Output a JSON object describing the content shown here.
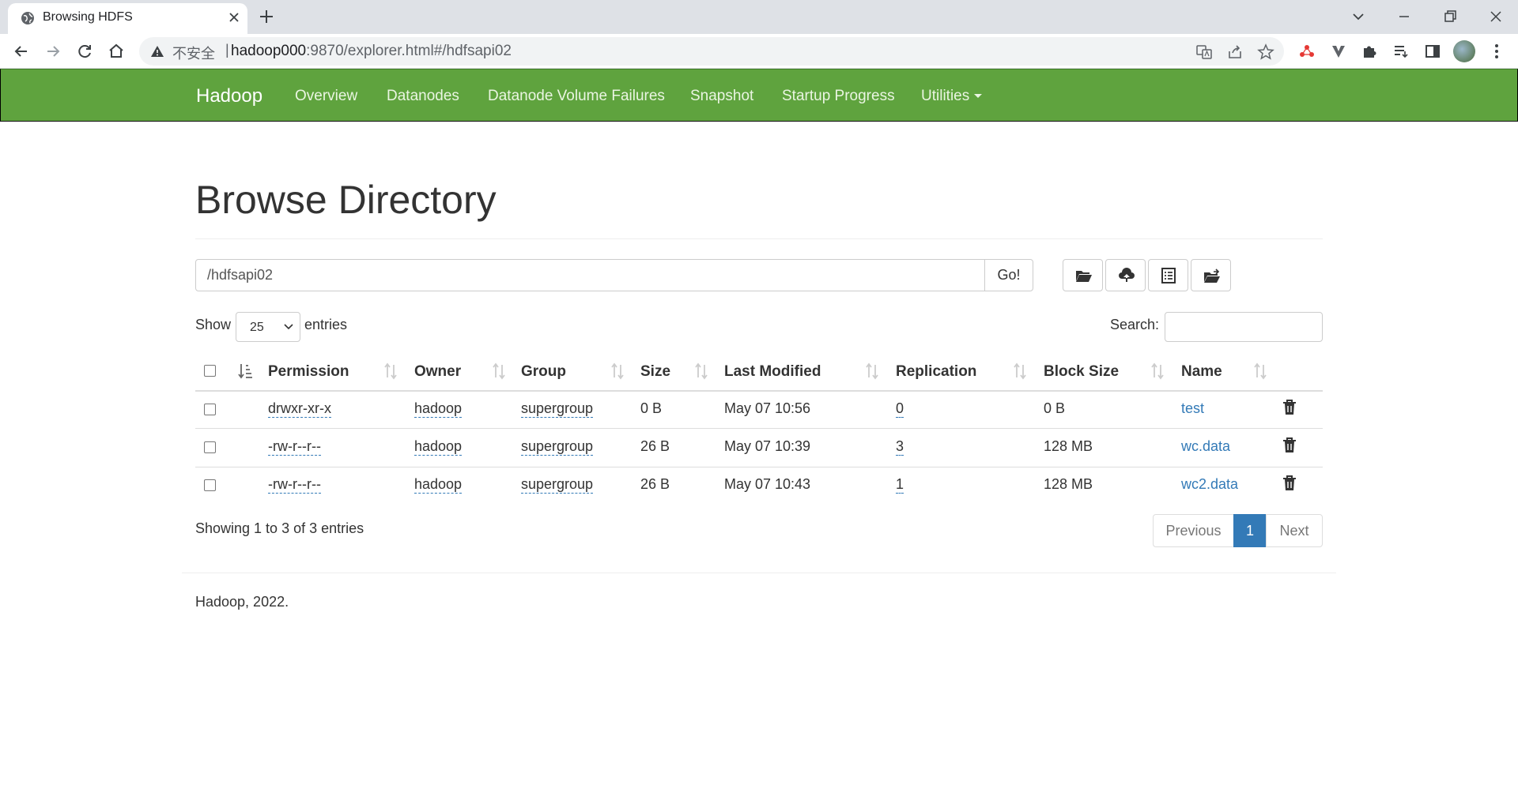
{
  "browser": {
    "tab_title": "Browsing HDFS",
    "security_label": "不安全",
    "url_host": "hadoop000",
    "url_rest": ":9870/explorer.html#/hdfsapi02"
  },
  "navbar": {
    "brand": "Hadoop",
    "items": [
      "Overview",
      "Datanodes",
      "Datanode Volume Failures",
      "Snapshot",
      "Startup Progress",
      "Utilities"
    ]
  },
  "page": {
    "title": "Browse Directory",
    "path_value": "/hdfsapi02",
    "go_label": "Go!",
    "show_label": "Show",
    "page_length": "25",
    "entries_label": "entries",
    "search_label": "Search:",
    "search_value": ""
  },
  "table": {
    "columns": [
      "Permission",
      "Owner",
      "Group",
      "Size",
      "Last Modified",
      "Replication",
      "Block Size",
      "Name"
    ],
    "rows": [
      {
        "permission": "drwxr-xr-x",
        "owner": "hadoop",
        "group": "supergroup",
        "size": "0 B",
        "last_modified": "May 07 10:56",
        "replication": "0",
        "block_size": "0 B",
        "name": "test"
      },
      {
        "permission": "-rw-r--r--",
        "owner": "hadoop",
        "group": "supergroup",
        "size": "26 B",
        "last_modified": "May 07 10:39",
        "replication": "3",
        "block_size": "128 MB",
        "name": "wc.data"
      },
      {
        "permission": "-rw-r--r--",
        "owner": "hadoop",
        "group": "supergroup",
        "size": "26 B",
        "last_modified": "May 07 10:43",
        "replication": "1",
        "block_size": "128 MB",
        "name": "wc2.data"
      }
    ]
  },
  "pagination": {
    "info": "Showing 1 to 3 of 3 entries",
    "previous": "Previous",
    "current": "1",
    "next": "Next"
  },
  "footer": {
    "text": "Hadoop, 2022."
  },
  "colors": {
    "navbar": "#5fa33e",
    "link": "#337ab7",
    "page_active": "#337ab7"
  }
}
